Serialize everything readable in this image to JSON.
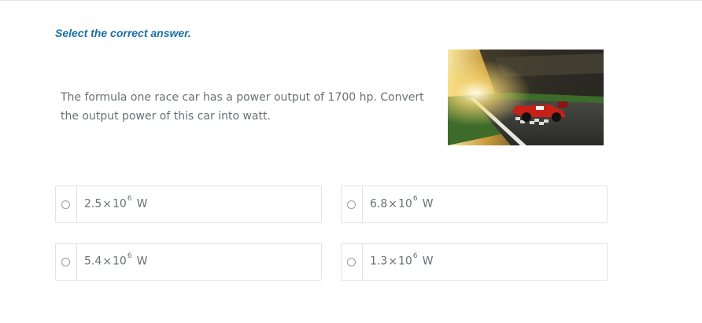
{
  "instruction": "Select the correct answer.",
  "question": "The formula one race car has a power output of 1700 hp. Convert the output power of this car into watt.",
  "image": {
    "description_icon": "race-car-image"
  },
  "options": [
    {
      "coefficient": "2.5",
      "times": "×",
      "base": "10",
      "exponent": "6",
      "unit": "W"
    },
    {
      "coefficient": "6.8",
      "times": "×",
      "base": "10",
      "exponent": "6",
      "unit": "W"
    },
    {
      "coefficient": "5.4",
      "times": "×",
      "base": "10",
      "exponent": "6",
      "unit": "W"
    },
    {
      "coefficient": "1.3",
      "times": "×",
      "base": "10",
      "exponent": "6",
      "unit": "W"
    }
  ],
  "colors": {
    "instruction": "#1c6fa6",
    "text": "#6a6f73",
    "border": "#e3e3e3"
  }
}
